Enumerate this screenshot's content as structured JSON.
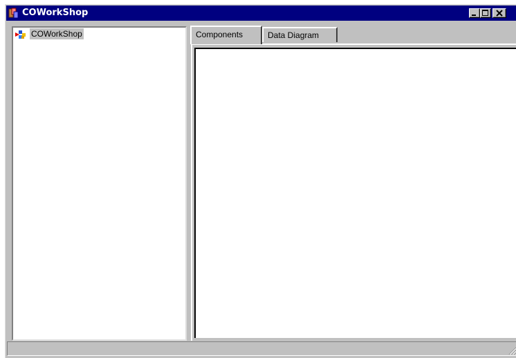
{
  "window": {
    "title": "COWorkShop",
    "title_bar_color": "#000080",
    "face_color": "#c0c0c0"
  },
  "tree": {
    "root_label": "COWorkShop",
    "root_icon": "workshop-icon"
  },
  "tabs": [
    {
      "label": "Components",
      "active": true
    },
    {
      "label": "Data Diagram",
      "active": false
    }
  ],
  "status": {
    "text": ""
  }
}
